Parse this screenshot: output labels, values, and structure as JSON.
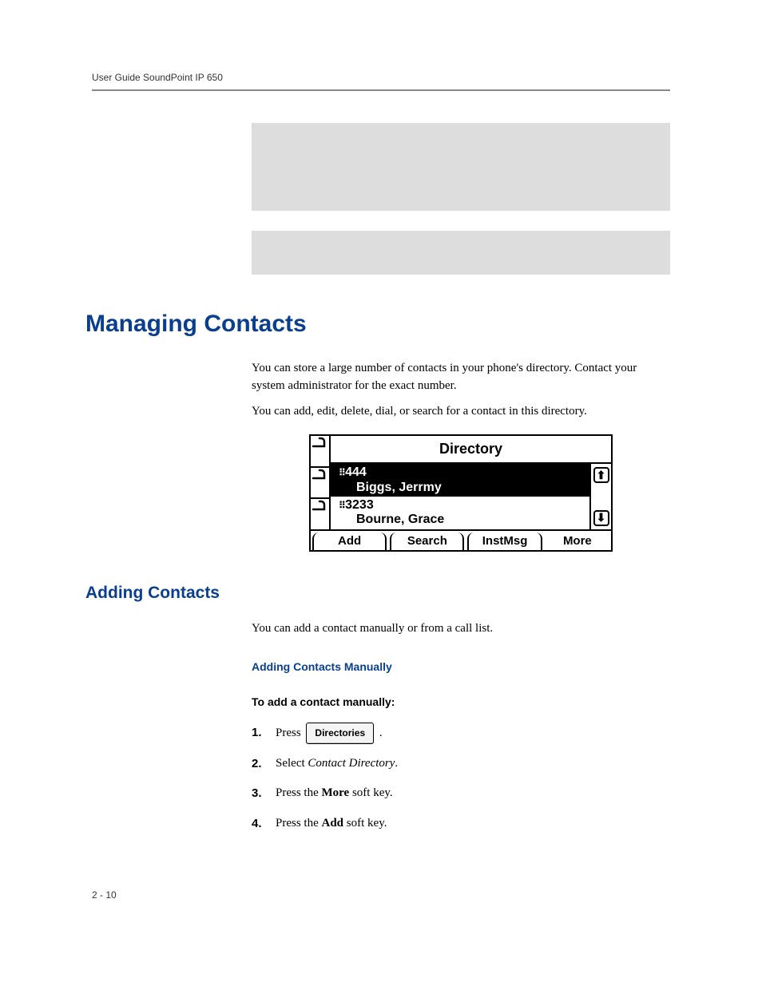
{
  "running_head": "User Guide SoundPoint IP 650",
  "h1": "Managing Contacts",
  "intro_p1": "You can store a large number of contacts in your phone's directory. Contact your system administrator for the exact number.",
  "intro_p2": "You can add, edit, delete, dial, or search for a contact in this directory.",
  "phone": {
    "title": "Directory",
    "entries": [
      {
        "num": "444",
        "name": "Biggs, Jerrmy"
      },
      {
        "num": "3233",
        "name": "Bourne, Grace"
      }
    ],
    "softkeys": [
      "Add",
      "Search",
      "InstMsg",
      "More"
    ]
  },
  "h2": "Adding Contacts",
  "adding_p": "You can add a contact manually or from a call list.",
  "h3": "Adding Contacts Manually",
  "h4": "To add a contact manually:",
  "steps": {
    "s1_a": "Press ",
    "s1_btn": "Directories",
    "s1_b": " .",
    "s2_a": "Select ",
    "s2_i": "Contact Directory",
    "s2_b": ".",
    "s3_a": "Press the ",
    "s3_bold": "More",
    "s3_b": " soft key.",
    "s4_a": "Press the ",
    "s4_bold": "Add",
    "s4_b": " soft key."
  },
  "page_num": "2 - 10"
}
